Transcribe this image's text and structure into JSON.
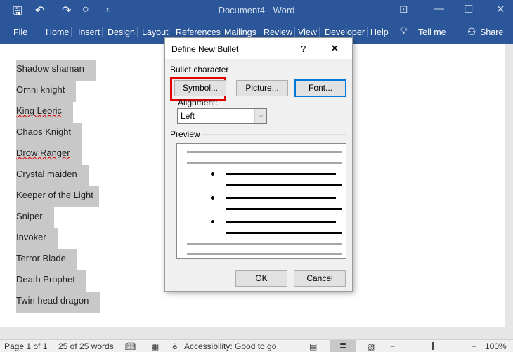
{
  "window": {
    "title": "Document4  -  Word",
    "accent": "#2b579a"
  },
  "ribbon": {
    "tabs": [
      "File",
      "Home",
      "Insert",
      "Design",
      "Layout",
      "References",
      "Mailings",
      "Review",
      "View",
      "Developer",
      "Help"
    ],
    "tell_me": "Tell me",
    "share": "Share"
  },
  "document": {
    "items": [
      "Shadow shaman",
      "Omni knight",
      "King Leoric",
      "Chaos Knight",
      "Drow Ranger",
      "Crystal maiden",
      "Keeper of the Light",
      "Sniper",
      "Invoker",
      "Terror Blade",
      "Death Prophet",
      "Twin head dragon"
    ]
  },
  "dialog": {
    "title": "Define New Bullet",
    "help": "?",
    "section_bullet": "Bullet character",
    "symbol": "Symbol...",
    "picture": "Picture...",
    "font": "Font...",
    "alignment_label": "Alignment:",
    "alignment_value": "Left",
    "section_preview": "Preview",
    "ok": "OK",
    "cancel": "Cancel",
    "highlight_color": "#e00000"
  },
  "status": {
    "page": "Page 1 of 1",
    "words": "25 of 25 words",
    "accessibility": "Accessibility: Good to go",
    "zoom": "100%"
  }
}
